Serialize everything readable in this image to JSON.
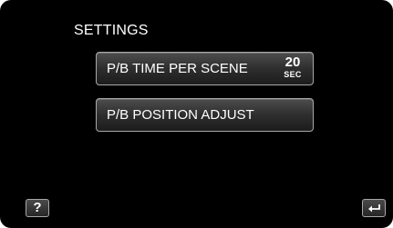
{
  "header": {
    "title": "SETTINGS"
  },
  "menu": {
    "items": [
      {
        "label": "P/B TIME PER SCENE",
        "value": "20",
        "unit": "SEC"
      },
      {
        "label": "P/B POSITION ADJUST"
      }
    ]
  },
  "footer": {
    "help_label": "?",
    "back_icon": "return-arrow-icon"
  },
  "colors": {
    "background": "#000000",
    "text": "#ffffff",
    "button_border": "#a8a8a8"
  }
}
